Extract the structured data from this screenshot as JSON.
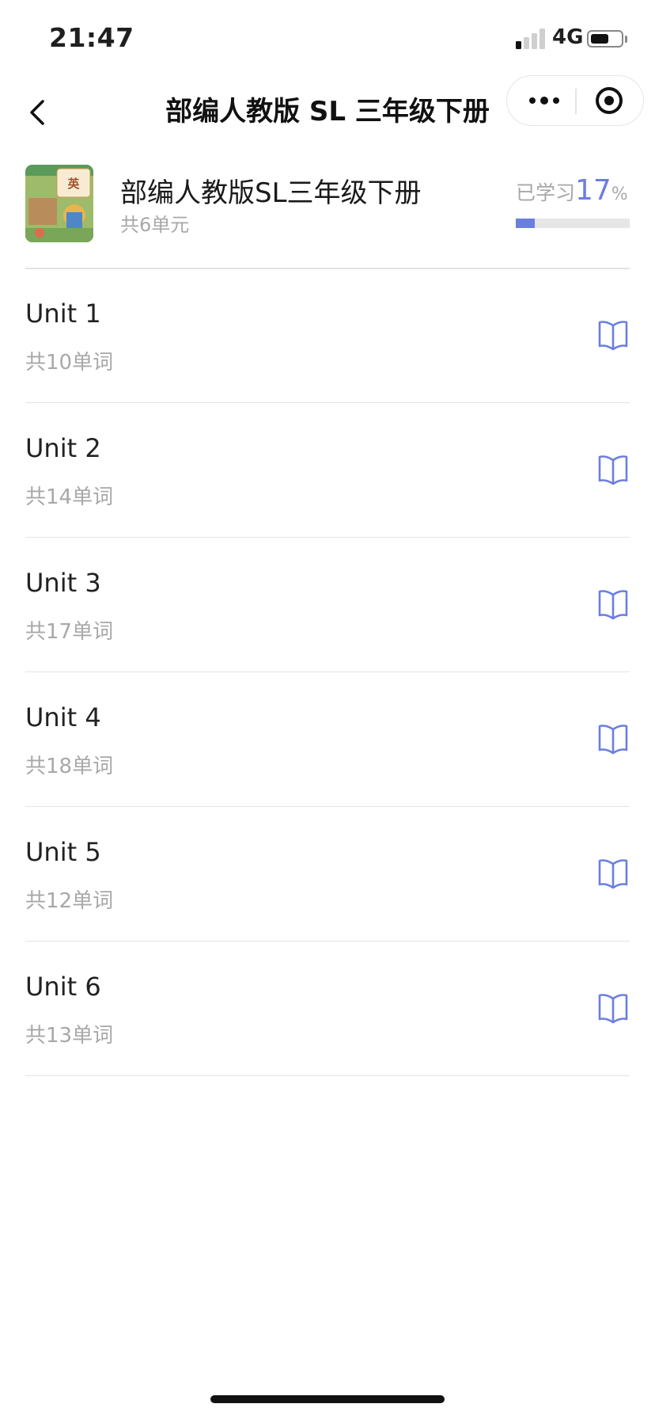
{
  "status_bar": {
    "time": "21:47",
    "network": "4G",
    "battery_level": 0.6,
    "signal_bars_on": 1,
    "signal_bars_total": 4
  },
  "nav": {
    "title": "部编人教版 SL 三年级下册",
    "back_icon": "chevron-left-icon",
    "more_icon": "more-dots-icon",
    "close_icon": "target-circle-icon"
  },
  "book": {
    "cover_icon": "textbook-cover-icon",
    "title": "部编人教版SL三年级下册",
    "subtitle": "共6单元",
    "progress_label": "已学习",
    "progress_value": "17",
    "progress_unit": "%",
    "progress_fraction": 0.17,
    "accent_color": "#6b7fe0"
  },
  "units": [
    {
      "name": "Unit 1",
      "count": "共10单词",
      "icon": "open-book-icon"
    },
    {
      "name": "Unit 2",
      "count": "共14单词",
      "icon": "open-book-icon"
    },
    {
      "name": "Unit 3",
      "count": "共17单词",
      "icon": "open-book-icon"
    },
    {
      "name": "Unit 4",
      "count": "共18单词",
      "icon": "open-book-icon"
    },
    {
      "name": "Unit 5",
      "count": "共12单词",
      "icon": "open-book-icon"
    },
    {
      "name": "Unit 6",
      "count": "共13单词",
      "icon": "open-book-icon"
    }
  ]
}
